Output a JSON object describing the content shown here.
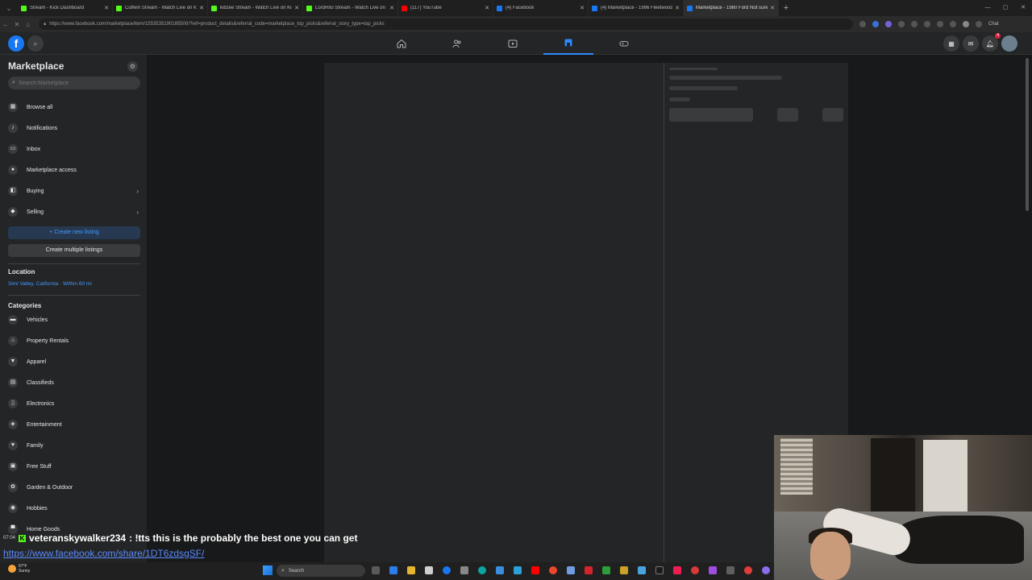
{
  "browser": {
    "tabs": [
      {
        "label": "Stream - Kick Dashboard",
        "color": "#53fc18"
      },
      {
        "label": "Cuffem Stream - Watch Live on Kick",
        "color": "#53fc18"
      },
      {
        "label": "kibzee Stream - Watch Live on Kick",
        "color": "#53fc18"
      },
      {
        "label": "LordRito Stream - Watch Live on Kick",
        "color": "#53fc18"
      },
      {
        "label": "(117) YouTube",
        "color": "#ff0000"
      },
      {
        "label": "(4) Facebook",
        "color": "#1877f2"
      },
      {
        "label": "(4) Marketplace - 1996 Fleetwood",
        "color": "#1877f2"
      },
      {
        "label": "Marketplace - 1980 Ford Not sure",
        "color": "#1877f2",
        "active": true
      }
    ],
    "url": "https://www.facebook.com/marketplace/item/1553535190185500/?ref=product_details&referral_code=marketplace_top_picks&referral_story_type=top_picks",
    "chat_label": "Chat",
    "new_tab_label": "+"
  },
  "fbnav": {
    "logo": "f",
    "tabs": [
      "home-icon",
      "friends-icon",
      "video-icon",
      "marketplace-icon",
      "gaming-icon"
    ],
    "active_tab": "marketplace-icon",
    "notification_count": "4"
  },
  "sidebar": {
    "title": "Marketplace",
    "search_placeholder": "Search Marketplace",
    "nav_items": [
      {
        "label": "Browse all",
        "icon": "store-icon"
      },
      {
        "label": "Notifications",
        "icon": "bell-icon"
      },
      {
        "label": "Inbox",
        "icon": "inbox-icon"
      },
      {
        "label": "Marketplace access",
        "icon": "access-icon"
      },
      {
        "label": "Buying",
        "icon": "bag-icon",
        "chevron": true
      },
      {
        "label": "Selling",
        "icon": "tag-icon",
        "chevron": true
      }
    ],
    "create_listing_label": "+ Create new listing",
    "create_multiple_label": "Create multiple listings",
    "location_heading": "Location",
    "location_value": "Simi Valley, California · Within 60 mi",
    "categories_heading": "Categories",
    "categories": [
      {
        "label": "Vehicles",
        "icon": "car-icon"
      },
      {
        "label": "Property Rentals",
        "icon": "house-icon"
      },
      {
        "label": "Apparel",
        "icon": "shirt-icon"
      },
      {
        "label": "Classifieds",
        "icon": "classifieds-icon"
      },
      {
        "label": "Electronics",
        "icon": "phone-icon"
      },
      {
        "label": "Entertainment",
        "icon": "ticket-icon"
      },
      {
        "label": "Family",
        "icon": "heart-icon"
      },
      {
        "label": "Free Stuff",
        "icon": "gift-icon"
      },
      {
        "label": "Garden & Outdoor",
        "icon": "plant-icon"
      },
      {
        "label": "Hobbies",
        "icon": "hobbies-icon"
      },
      {
        "label": "Home Goods",
        "icon": "sofa-icon"
      }
    ]
  },
  "overlay": {
    "chat_time": "07:04",
    "chat_user": "veteranskywalker234",
    "chat_message": ": !tts this is the probably the best one you can get",
    "link": "https://www.facebook.com/share/1DT6zdsgSF/"
  },
  "taskbar": {
    "weather_temp": "67°F",
    "weather_desc": "Sunny",
    "search_label": "Search"
  }
}
